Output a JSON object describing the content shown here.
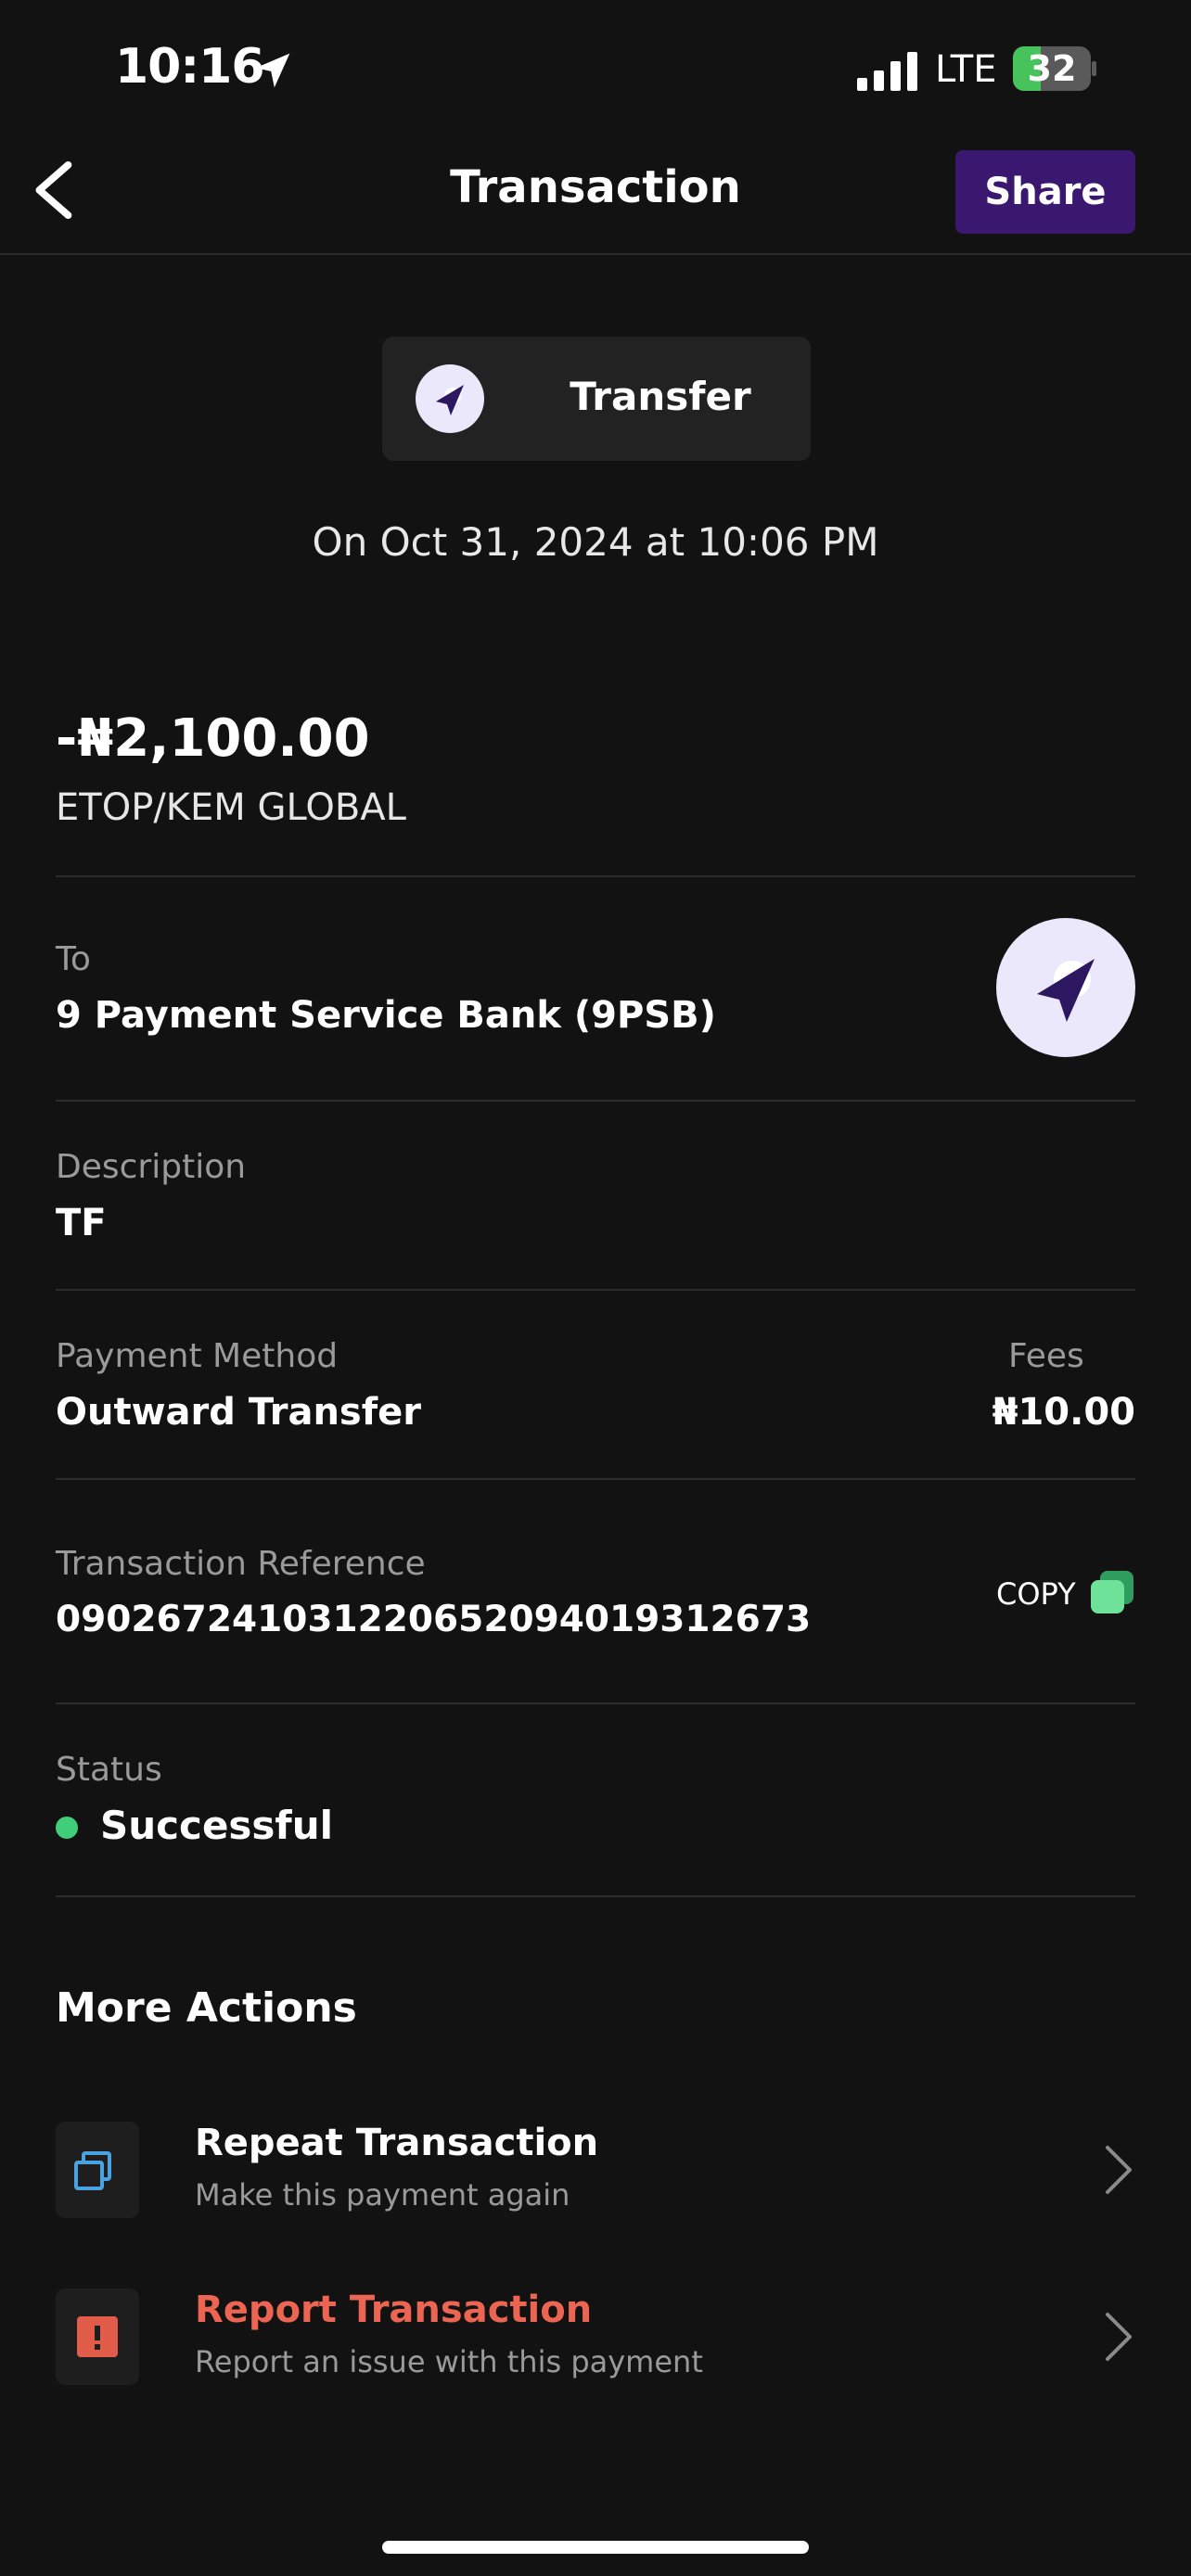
{
  "status_bar": {
    "time": "10:16",
    "network": "LTE",
    "battery": "32"
  },
  "header": {
    "title": "Transaction",
    "share_label": "Share"
  },
  "type_chip": {
    "label": "Transfer",
    "icon": "send-icon"
  },
  "date": "On Oct 31, 2024 at 10:06 PM",
  "amount": {
    "value": "-₦2,100.00",
    "counterparty": "ETOP/KEM GLOBAL"
  },
  "to": {
    "label": "To",
    "value": "9 Payment Service Bank (9PSB)"
  },
  "description": {
    "label": "Description",
    "value": "TF"
  },
  "payment_method": {
    "label": "Payment Method",
    "value": "Outward Transfer"
  },
  "fees": {
    "label": "Fees",
    "value": "₦10.00"
  },
  "reference": {
    "label": "Transaction Reference",
    "value": "090267241031220652094019312673",
    "copy_label": "COPY"
  },
  "status": {
    "label": "Status",
    "value": "Successful",
    "color": "#3fcf7b"
  },
  "more_actions": {
    "title": "More Actions",
    "items": [
      {
        "title": "Repeat Transaction",
        "subtitle": "Make this payment again",
        "title_color": "#ffffff",
        "icon": "copy-icon"
      },
      {
        "title": "Report Transaction",
        "subtitle": "Report an issue with this payment",
        "title_color": "#ec6553",
        "icon": "alert-icon"
      }
    ]
  },
  "colors": {
    "background": "#121212",
    "share_button": "#3a1870",
    "accent_purple": "#3a1870",
    "icon_bg": "#ece8fb"
  }
}
